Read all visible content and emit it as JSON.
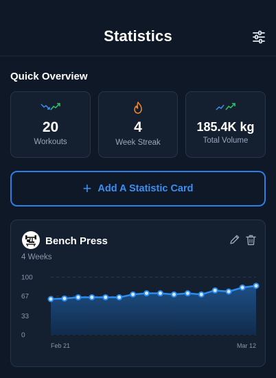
{
  "header": {
    "title": "Statistics",
    "filter_icon": "sliders-icon"
  },
  "overview": {
    "title": "Quick Overview",
    "cards": [
      {
        "value": "20",
        "label": "Workouts",
        "icon": "trend-arrows-icon"
      },
      {
        "value": "4",
        "label": "Week Streak",
        "icon": "flame-icon"
      },
      {
        "value": "185.4K kg",
        "label": "Total Volume",
        "icon": "trend-up-icon"
      }
    ]
  },
  "add_card": {
    "label": "Add A Statistic Card"
  },
  "exercise_card": {
    "name": "Bench Press",
    "period": "4 Weeks",
    "colors": {
      "accent": "#2b8cf0",
      "fill_top": "#1d4f86",
      "fill_bottom": "#122b4a"
    }
  },
  "chart_data": {
    "type": "area",
    "x_tick_labels": [
      "Feb 21",
      "Mar 12"
    ],
    "y_ticks": [
      0,
      33,
      67,
      100
    ],
    "ylim": [
      0,
      100
    ],
    "values": [
      62,
      63,
      65,
      65,
      65,
      65,
      70,
      72,
      72,
      70,
      72,
      70,
      77,
      75,
      82,
      85
    ],
    "grid": true
  }
}
